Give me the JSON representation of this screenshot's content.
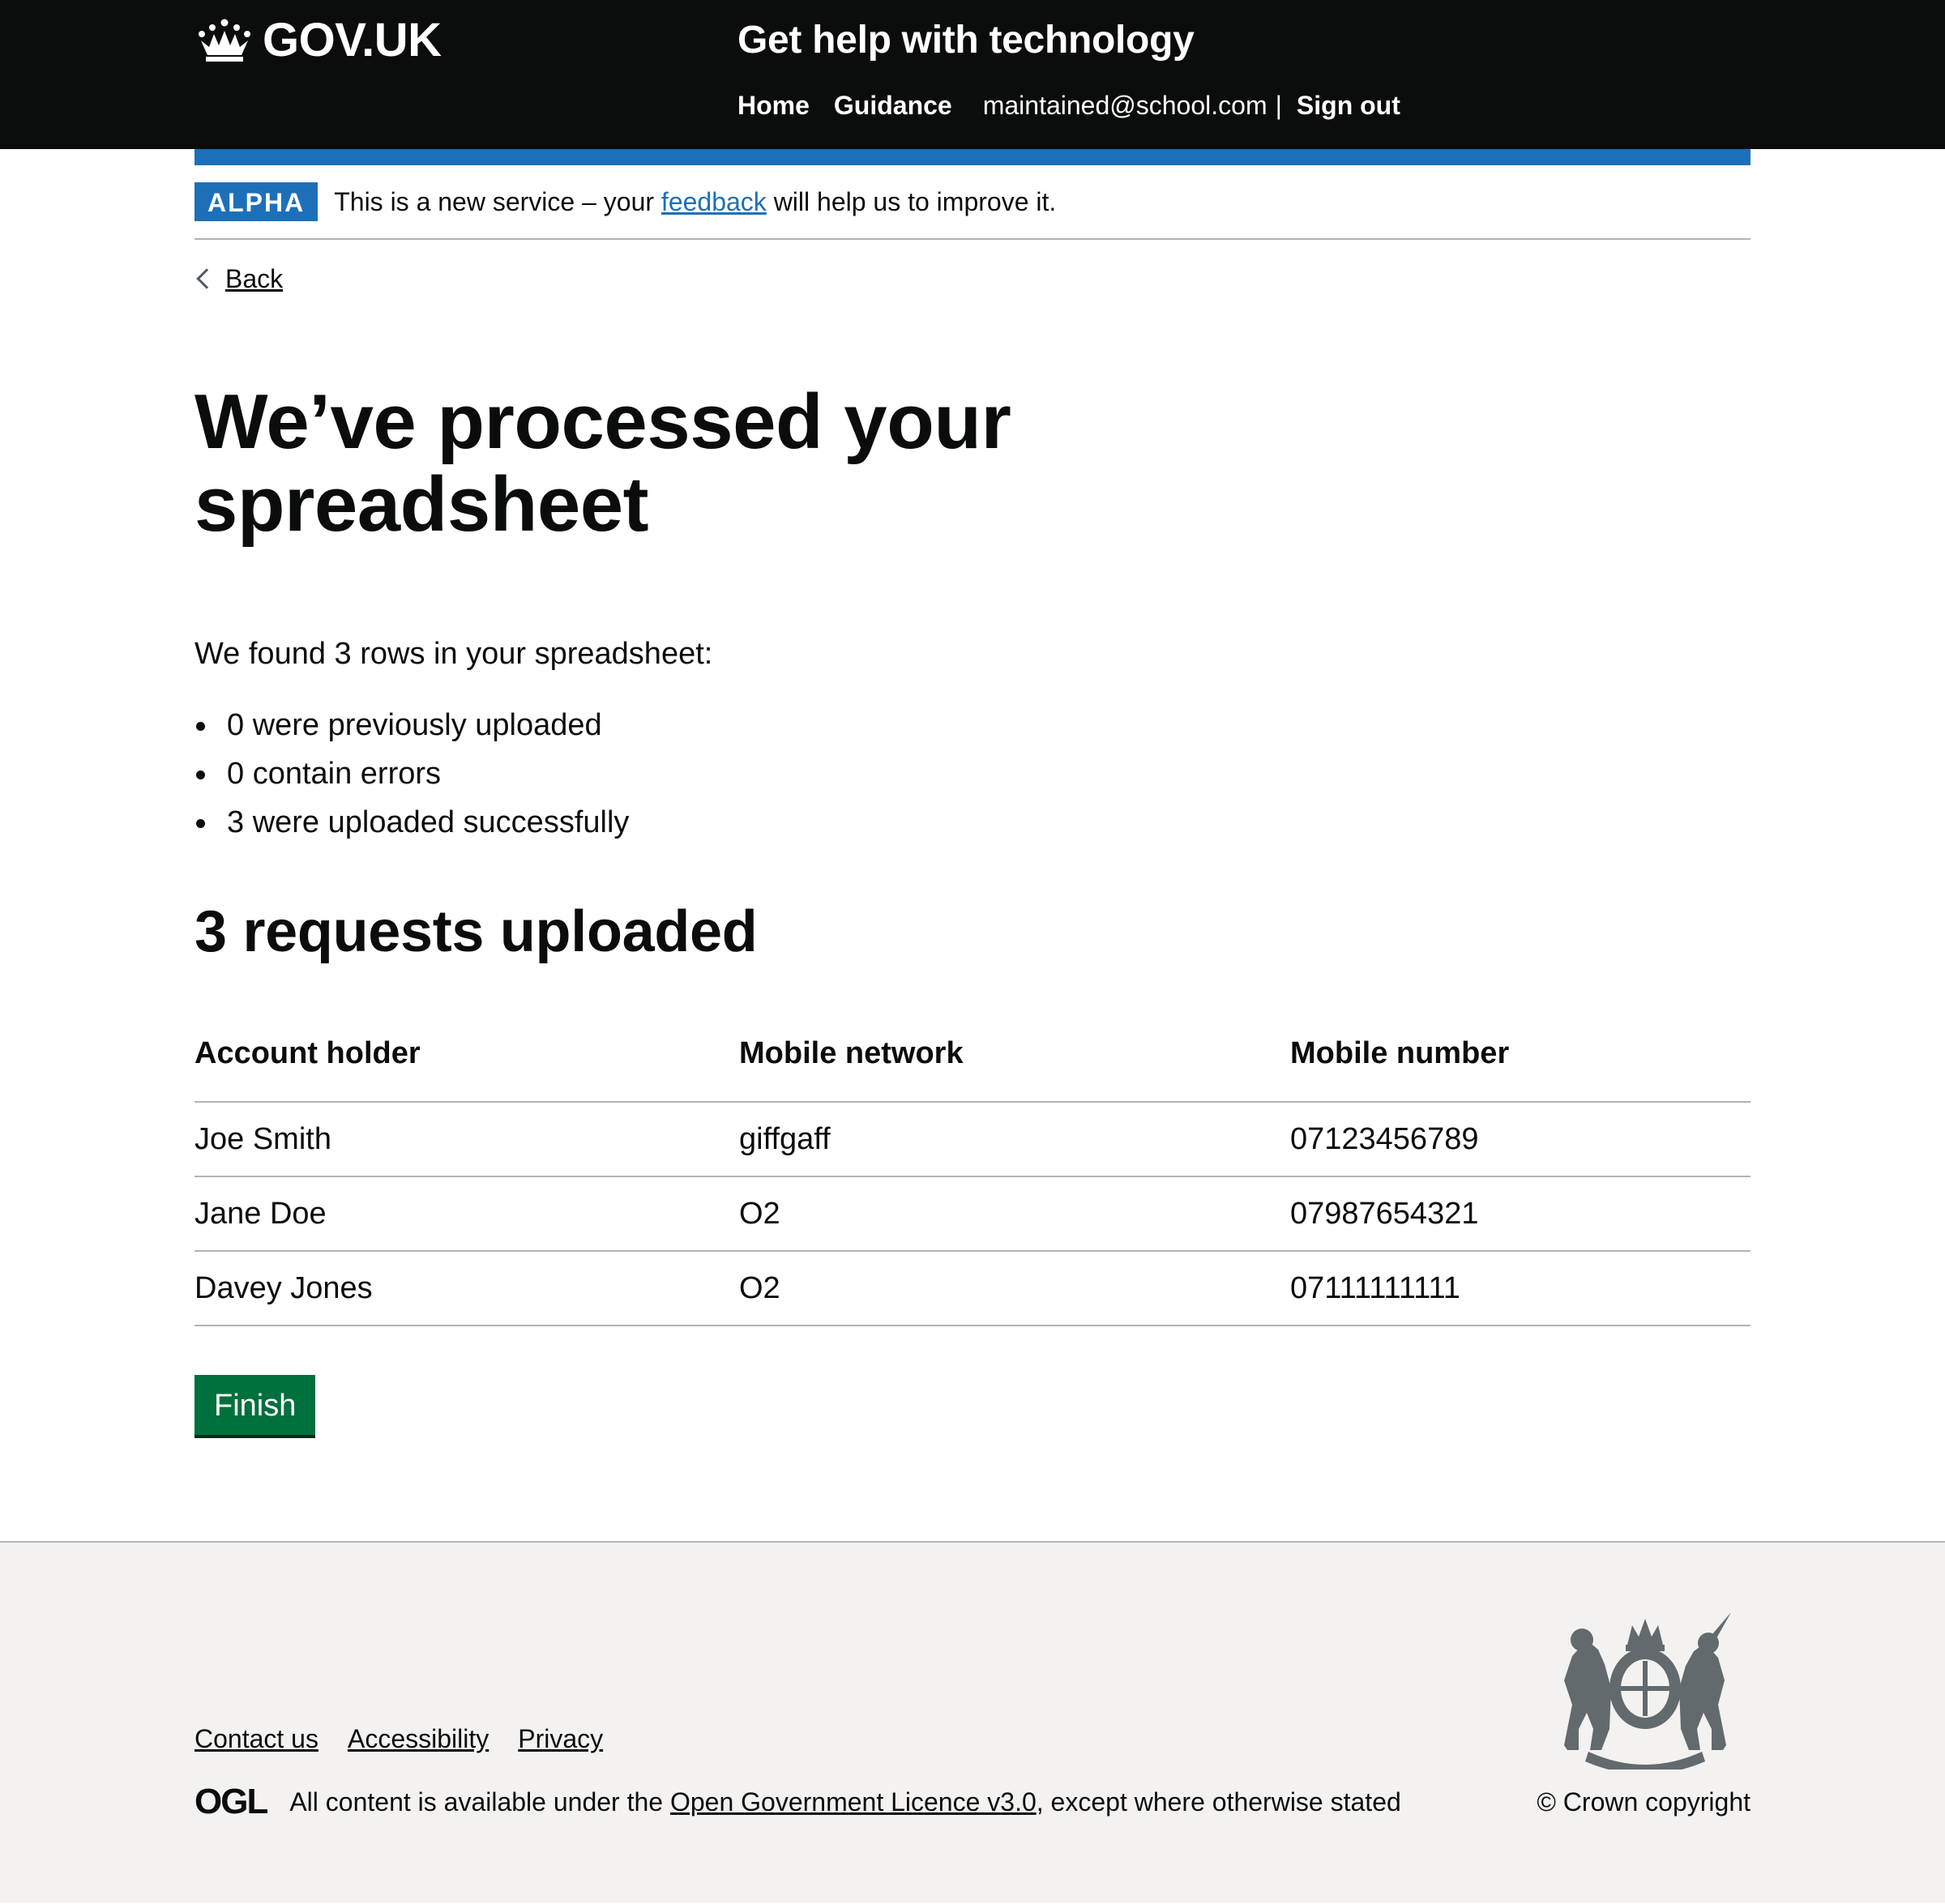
{
  "header": {
    "logo_text": "GOV.UK",
    "service_name": "Get help with technology",
    "nav": {
      "home": "Home",
      "guidance": "Guidance",
      "user_email": "maintained@school.com",
      "separator": "|",
      "sign_out": "Sign out"
    }
  },
  "phase_banner": {
    "tag": "ALPHA",
    "text_before": "This is a new service – your ",
    "link": "feedback",
    "text_after": " will help us to improve it."
  },
  "back_link": "Back",
  "main": {
    "title": "We’ve processed your spreadsheet",
    "lead": "We found 3 rows in your spreadsheet:",
    "bullets": [
      "0 were previously uploaded",
      "0 contain errors",
      "3 were uploaded successfully"
    ],
    "subtitle": "3 requests uploaded",
    "table": {
      "headers": [
        "Account holder",
        "Mobile network",
        "Mobile number"
      ],
      "rows": [
        [
          "Joe Smith",
          "giffgaff",
          "07123456789"
        ],
        [
          "Jane Doe",
          "O2",
          "07987654321"
        ],
        [
          "Davey Jones",
          "O2",
          "07111111111"
        ]
      ]
    },
    "finish_button": "Finish"
  },
  "footer": {
    "links": [
      "Contact us",
      "Accessibility",
      "Privacy"
    ],
    "ogl_logo": "OGL",
    "licence_before": "All content is available under the ",
    "licence_link": "Open Government Licence v3.0",
    "licence_after": ", except where otherwise stated",
    "copyright": "© Crown copyright"
  },
  "colors": {
    "header_bg": "#0b0c0c",
    "brand_blue": "#1d70b8",
    "button_green": "#00703c",
    "footer_bg": "#f3f2f1",
    "border_grey": "#b1b4b6"
  },
  "icons": {
    "logo": "crown-icon",
    "back": "chevron-left-icon",
    "crest": "royal-coat-of-arms-icon"
  }
}
